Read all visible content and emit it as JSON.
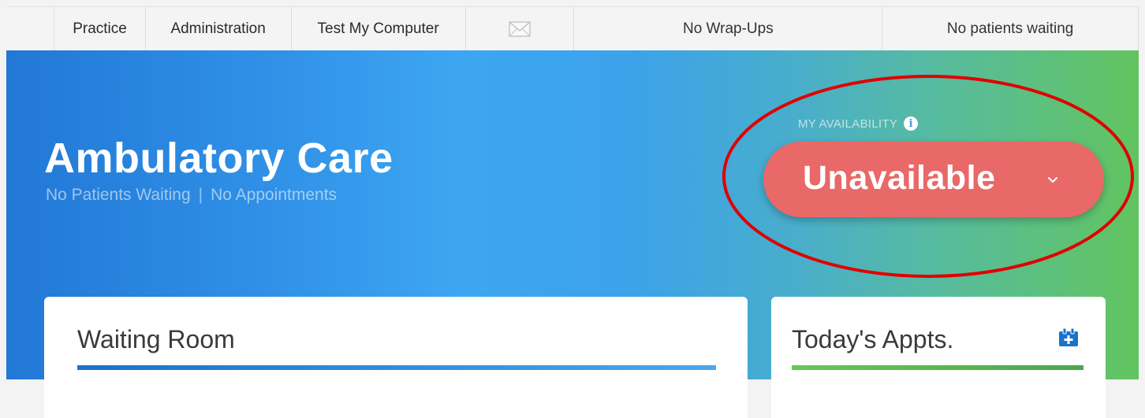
{
  "nav": {
    "items": [
      {
        "label": "Practice"
      },
      {
        "label": "Administration"
      },
      {
        "label": "Test My Computer"
      }
    ],
    "mail_icon": "envelope-icon",
    "wrapups": "No Wrap-Ups",
    "patients_waiting": "No patients waiting"
  },
  "hero": {
    "title": "Ambulatory Care",
    "status_patients": "No Patients Waiting",
    "separator": "|",
    "status_appointments": "No Appointments"
  },
  "availability": {
    "label": "MY AVAILABILITY",
    "info_icon": "info-icon",
    "status": "Unavailable",
    "status_color": "#e96868",
    "chevron_icon": "chevron-down-icon"
  },
  "annotation": {
    "color": "#e00000"
  },
  "cards": {
    "waiting_room": {
      "title": "Waiting Room",
      "accent": "#1f6fc7"
    },
    "todays_appts": {
      "title": "Today's Appts.",
      "accent": "#5fcb52",
      "icon": "calendar-add-icon"
    }
  }
}
